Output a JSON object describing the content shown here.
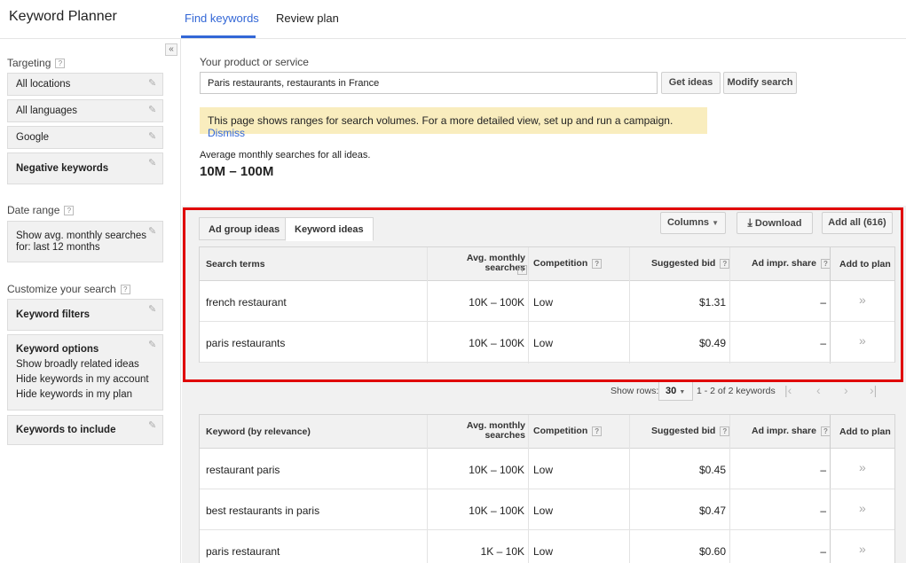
{
  "header": {
    "app_title": "Keyword Planner",
    "tabs": [
      {
        "label": "Find keywords",
        "active": true
      },
      {
        "label": "Review plan",
        "active": false
      }
    ],
    "accent_color": "#3367d6"
  },
  "sidebar": {
    "collapse_icon": "«",
    "targeting_label": "Targeting",
    "targeting_items": [
      "All locations",
      "All languages",
      "Google",
      "Negative keywords"
    ],
    "date_range_label": "Date range",
    "date_range_lines": [
      "Show avg. monthly searches",
      "for: last 12 months"
    ],
    "customize_label": "Customize your search",
    "keyword_filters": "Keyword filters",
    "keyword_options": {
      "title": "Keyword options",
      "lines": [
        "Show broadly related ideas",
        "Hide keywords in my account",
        "Hide keywords in my plan"
      ]
    },
    "keywords_to_include": "Keywords to include",
    "help_glyph": "?",
    "pencil_icon": "✎"
  },
  "main": {
    "product_label": "Your product or service",
    "search_value": "Paris restaurants, restaurants in France",
    "get_ideas": "Get ideas",
    "modify_search": "Modify search",
    "notice_text": "This page shows ranges for search volumes. For a more detailed view, set up and run a campaign.",
    "notice_link": "Dismiss",
    "notice_color": "#f9edbe",
    "avg_label": "Average monthly searches for all ideas.",
    "avg_value": "10M – 100M"
  },
  "ideas": {
    "tabs": [
      "Ad group ideas",
      "Keyword ideas"
    ],
    "columns_btn": "Columns",
    "download_btn": "Download",
    "add_all_btn": "Add all (616)",
    "highlight_color": "#e00000"
  },
  "search_terms_table": {
    "headers": {
      "term": "Search terms",
      "avg_line1": "Avg. monthly",
      "avg_line2": "searches",
      "competition": "Competition",
      "bid": "Suggested bid",
      "share": "Ad impr. share",
      "add": "Add to plan"
    },
    "rows": [
      {
        "term": "french restaurant",
        "avg": "10K – 100K",
        "competition": "Low",
        "bid": "$1.31",
        "share": "–"
      },
      {
        "term": "paris restaurants",
        "avg": "10K – 100K",
        "competition": "Low",
        "bid": "$0.49",
        "share": "–"
      }
    ]
  },
  "pager": {
    "show_rows_label": "Show rows:",
    "rows_value": "30",
    "range_text": "1 - 2 of 2 keywords",
    "first": "|‹",
    "prev": "‹",
    "next": "›",
    "last": "›|"
  },
  "keyword_table": {
    "headers": {
      "term": "Keyword (by relevance)",
      "avg_line1": "Avg. monthly",
      "avg_line2": "searches",
      "competition": "Competition",
      "bid": "Suggested bid",
      "share": "Ad impr. share",
      "add": "Add to plan"
    },
    "rows": [
      {
        "term": "restaurant paris",
        "avg": "10K – 100K",
        "competition": "Low",
        "bid": "$0.45",
        "share": "–"
      },
      {
        "term": "best restaurants in paris",
        "avg": "10K – 100K",
        "competition": "Low",
        "bid": "$0.47",
        "share": "–"
      },
      {
        "term": "paris restaurant",
        "avg": "1K – 10K",
        "competition": "Low",
        "bid": "$0.60",
        "share": "–"
      }
    ]
  },
  "add_icon": "»"
}
